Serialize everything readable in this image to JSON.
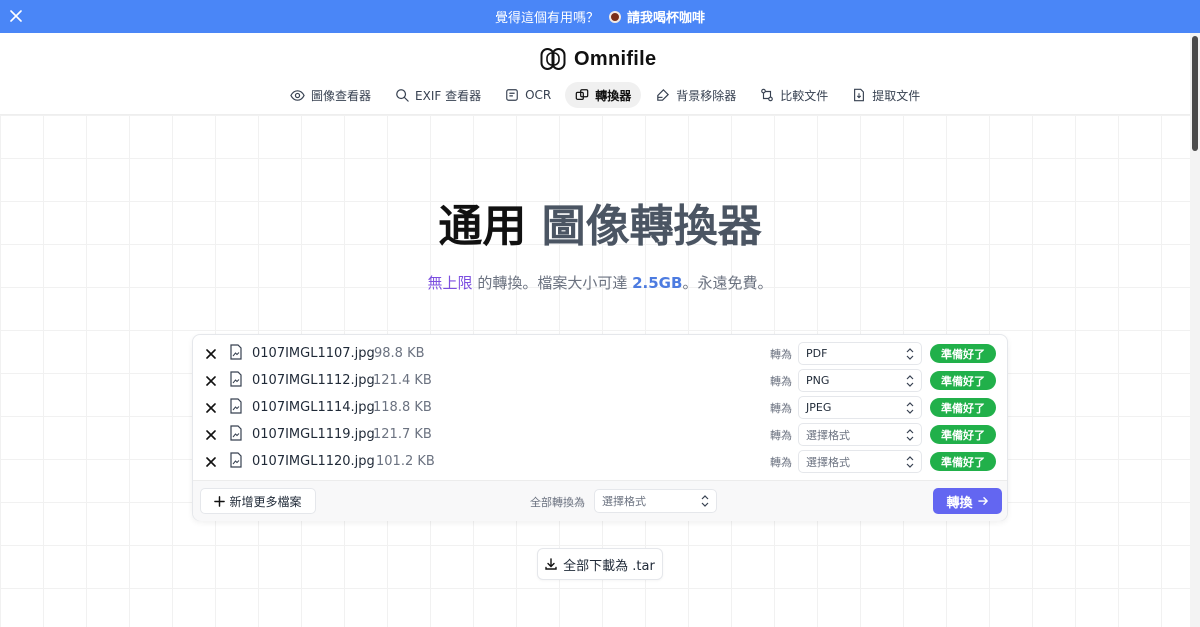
{
  "banner": {
    "question": "覺得這個有用嗎？",
    "link_label": "請我喝杯咖啡",
    "bg_color": "#4a86f7"
  },
  "brand": {
    "name": "Omnifile"
  },
  "nav": [
    {
      "label": "圖像查看器",
      "icon": "eye-icon"
    },
    {
      "label": "EXIF 查看器",
      "icon": "search-icon"
    },
    {
      "label": "OCR",
      "icon": "ocr-icon"
    },
    {
      "label": "轉換器",
      "icon": "convert-icon",
      "active": true
    },
    {
      "label": "背景移除器",
      "icon": "brush-icon"
    },
    {
      "label": "比較文件",
      "icon": "compare-icon"
    },
    {
      "label": "提取文件",
      "icon": "extract-icon"
    }
  ],
  "hero": {
    "title_a": "通用",
    "title_b": "圖像轉換器",
    "sub_hl1": "無上限",
    "sub_mid": " 的轉換。檔案大小可達 ",
    "sub_hl2": "2.5GB",
    "sub_end": "。永遠免費。"
  },
  "files": [
    {
      "name": "0107IMGL1107.jpg",
      "size": "98.8 KB",
      "to_label": "轉為",
      "format": "PDF",
      "status": "準備好了"
    },
    {
      "name": "0107IMGL1112.jpg",
      "size": "121.4 KB",
      "to_label": "轉為",
      "format": "PNG",
      "status": "準備好了"
    },
    {
      "name": "0107IMGL1114.jpg",
      "size": "118.8 KB",
      "to_label": "轉為",
      "format": "JPEG",
      "status": "準備好了"
    },
    {
      "name": "0107IMGL1119.jpg",
      "size": "121.7 KB",
      "to_label": "轉為",
      "format": "選擇格式",
      "status": "準備好了"
    },
    {
      "name": "0107IMGL1120.jpg",
      "size": "101.2 KB",
      "to_label": "轉為",
      "format": "選擇格式",
      "status": "準備好了"
    }
  ],
  "actions": {
    "add_more": "新增更多檔案",
    "convert_all_label": "全部轉換為",
    "convert_all_placeholder": "選擇格式",
    "convert": "轉換",
    "download_all": "全部下載為 .tar"
  },
  "colors": {
    "accent": "#6366f1",
    "ready": "#21b04a",
    "highlight_purple": "#7c4fe0",
    "highlight_blue": "#4c7be0"
  }
}
